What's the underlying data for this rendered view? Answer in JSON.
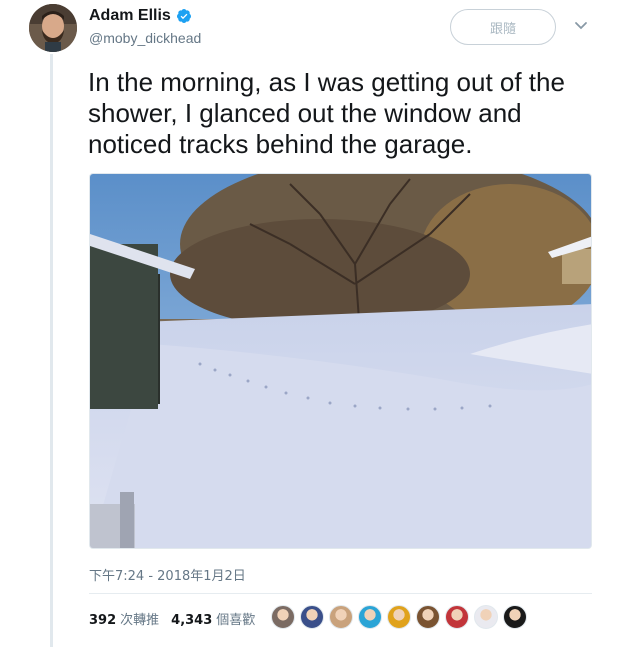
{
  "author": {
    "name": "Adam Ellis",
    "handle": "@moby_dickhead",
    "verified": true,
    "avatar_icon": "profile-avatar"
  },
  "follow_button": {
    "label": "跟隨"
  },
  "menu": {
    "icon": "chevron-down-icon"
  },
  "tweet": {
    "text": "In the morning, as I was getting out of the shower, I glanced out the window and noticed tracks behind the garage."
  },
  "media": {
    "alt_icon": "photo-snowy-backyard"
  },
  "timestamp": "下午7:24 - 2018年1月2日",
  "stats": {
    "retweets": {
      "count": "392",
      "label": "次轉推"
    },
    "likes": {
      "count": "4,343",
      "label": "個喜歡"
    }
  },
  "likers": [
    {
      "color": "#7b6b63"
    },
    {
      "color": "#3a4f8a"
    },
    {
      "color": "#c9a27c"
    },
    {
      "color": "#2aa4d6"
    },
    {
      "color": "#e0a21c"
    },
    {
      "color": "#7a5331"
    },
    {
      "color": "#c2353a"
    },
    {
      "color": "#eaeaf0"
    },
    {
      "color": "#1a1a1a"
    }
  ],
  "colors": {
    "verified_blue": "#1da1f2",
    "secondary_text": "#657786",
    "primary_text": "#14171a"
  }
}
